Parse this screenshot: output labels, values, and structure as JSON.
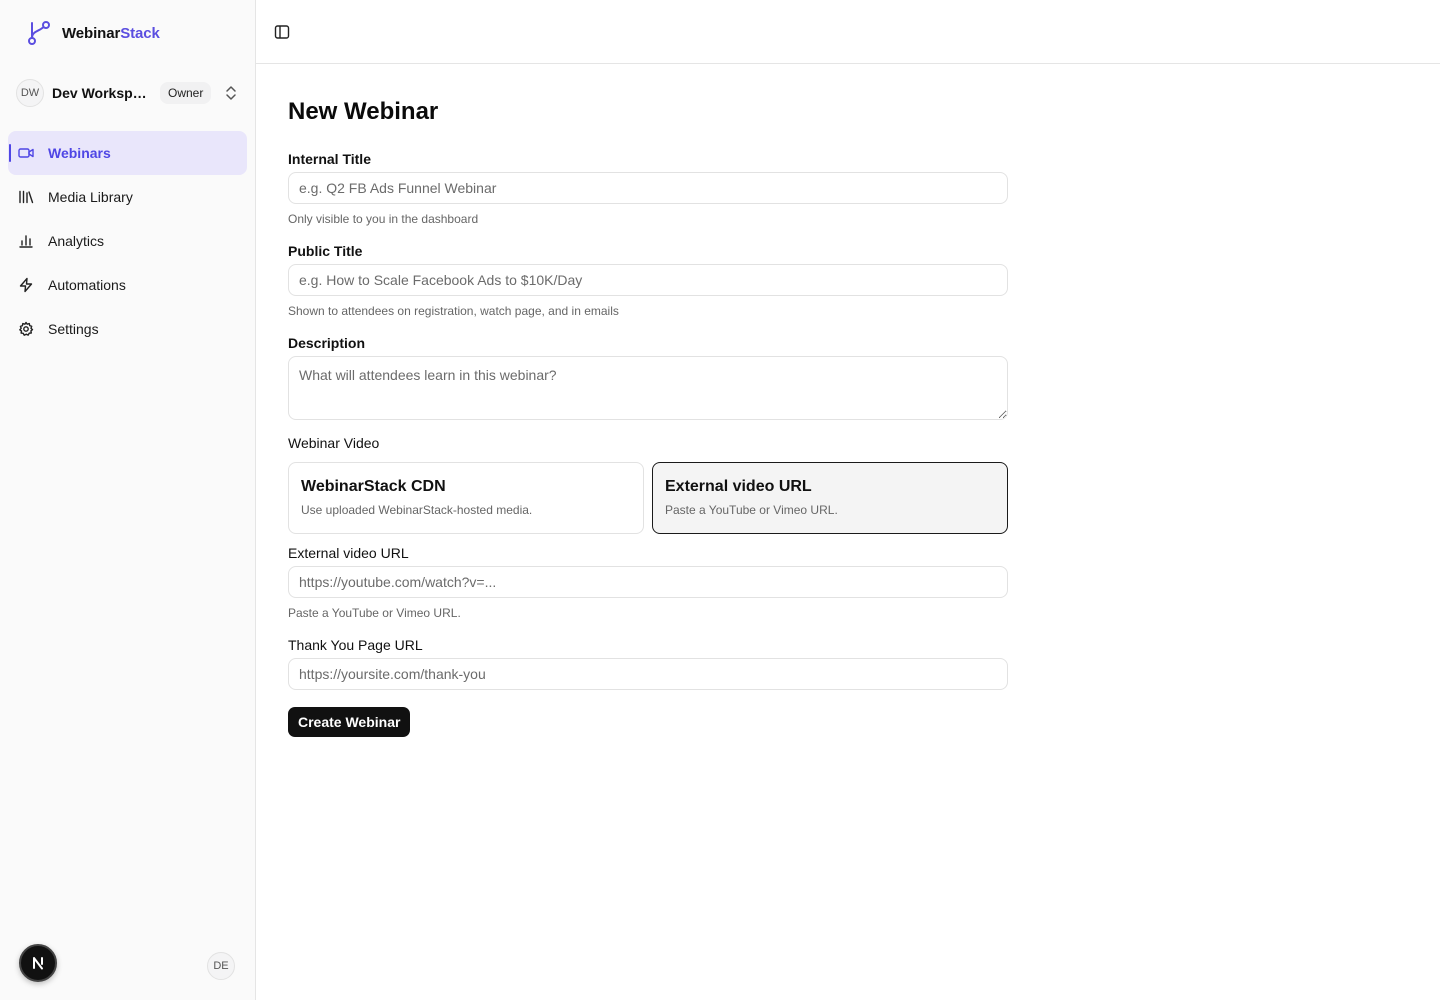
{
  "brand": {
    "name_part1": "Webinar",
    "name_part2": "Stack",
    "logo_icon": "branch-icon"
  },
  "workspace": {
    "initials": "DW",
    "name": "Dev Workspace",
    "role": "Owner",
    "switch_icon": "chevrons-up-down-icon"
  },
  "nav": {
    "items": [
      {
        "label": "Webinars",
        "icon": "video-icon",
        "active": true
      },
      {
        "label": "Media Library",
        "icon": "library-icon",
        "active": false
      },
      {
        "label": "Analytics",
        "icon": "bar-chart-icon",
        "active": false
      },
      {
        "label": "Automations",
        "icon": "zap-icon",
        "active": false
      },
      {
        "label": "Settings",
        "icon": "gear-icon",
        "active": false
      }
    ]
  },
  "footer": {
    "dev_badge": "N",
    "user_initials": "DE"
  },
  "topbar": {
    "toggle_icon": "panel-left-icon"
  },
  "form": {
    "title": "New Webinar",
    "internal_title": {
      "label": "Internal Title",
      "placeholder": "e.g. Q2 FB Ads Funnel Webinar",
      "hint": "Only visible to you in the dashboard"
    },
    "public_title": {
      "label": "Public Title",
      "placeholder": "e.g. How to Scale Facebook Ads to $10K/Day",
      "hint": "Shown to attendees on registration, watch page, and in emails"
    },
    "description": {
      "label": "Description",
      "placeholder": "What will attendees learn in this webinar?"
    },
    "video": {
      "label": "Webinar Video",
      "options": [
        {
          "title": "WebinarStack CDN",
          "desc": "Use uploaded WebinarStack-hosted media.",
          "selected": false
        },
        {
          "title": "External video URL",
          "desc": "Paste a YouTube or Vimeo URL.",
          "selected": true
        }
      ]
    },
    "external_url": {
      "label": "External video URL",
      "placeholder": "https://youtube.com/watch?v=...",
      "hint": "Paste a YouTube or Vimeo URL."
    },
    "thank_you": {
      "label": "Thank You Page URL",
      "placeholder": "https://yoursite.com/thank-you"
    },
    "submit_label": "Create Webinar"
  },
  "colors": {
    "accent": "#4f46e5",
    "active_bg": "#e9e6fb",
    "button_bg": "#111111"
  }
}
